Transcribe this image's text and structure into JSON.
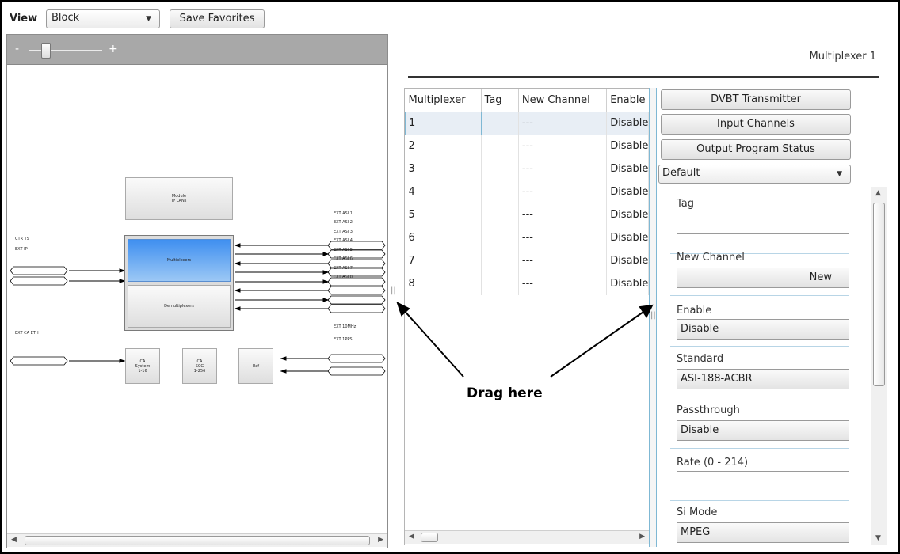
{
  "toolbar": {
    "view_label": "View",
    "view_value": "Block",
    "save_favorites": "Save Favorites"
  },
  "zoom": {
    "minus": "-",
    "plus": "+",
    "level": 0.2
  },
  "diagram": {
    "module_box": "Module\nIP LANs",
    "mux_box": "Multiplexers",
    "demux_box": "Demultiplexers",
    "ca_system": "CA\nSystem\n1-16",
    "ca_scg": "CA\nSCG\n1-256",
    "ref_box": "Ref",
    "left_inputs": [
      "CTR TS",
      "EXT IP"
    ],
    "ext_asi": [
      "EXT ASI 1",
      "EXT ASI 2",
      "EXT ASI 3",
      "EXT ASI 4",
      "EXT ASI 5",
      "EXT ASI 6",
      "EXT ASI 7",
      "EXT ASI 8"
    ],
    "ca_eth": "EXT CA ETH",
    "ref_inputs": [
      "EXT 10MHz",
      "EXT 1PPS"
    ]
  },
  "header": {
    "title": "Multiplexer 1"
  },
  "grid": {
    "columns": [
      "Multiplexer",
      "Tag",
      "New Channel",
      "Enable"
    ],
    "rows": [
      [
        "1",
        "",
        "---",
        "Disable"
      ],
      [
        "2",
        "",
        "---",
        "Disable"
      ],
      [
        "3",
        "",
        "---",
        "Disable"
      ],
      [
        "4",
        "",
        "---",
        "Disable"
      ],
      [
        "5",
        "",
        "---",
        "Disable"
      ],
      [
        "6",
        "",
        "---",
        "Disable"
      ],
      [
        "7",
        "",
        "---",
        "Disable"
      ],
      [
        "8",
        "",
        "---",
        "Disable"
      ]
    ]
  },
  "side_buttons": {
    "dvbt": "DVBT Transmitter",
    "inputs": "Input Channels",
    "output": "Output Program Status",
    "preset": "Default"
  },
  "properties": {
    "tag": {
      "label": "Tag",
      "value": ""
    },
    "new_channel": {
      "label": "New Channel",
      "button": "New"
    },
    "enable": {
      "label": "Enable",
      "value": "Disable"
    },
    "standard": {
      "label": "Standard",
      "value": "ASI-188-ACBR"
    },
    "passthrough": {
      "label": "Passthrough",
      "value": "Disable"
    },
    "rate": {
      "label": "Rate (0 - 214)",
      "value": ""
    },
    "si_mode": {
      "label": "Si Mode",
      "value": "MPEG"
    }
  },
  "annotation": "Drag here",
  "splitter_grip": "||"
}
